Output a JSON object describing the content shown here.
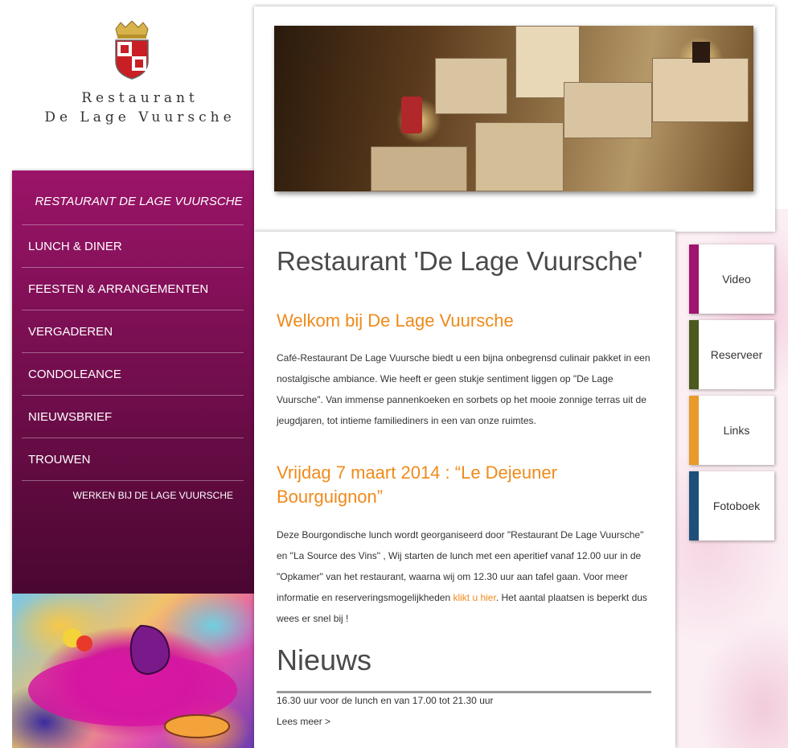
{
  "brand": {
    "line1": "Restaurant",
    "line2": "De Lage Vuursche",
    "logo_icon": "crest-icon"
  },
  "nav": {
    "title": "RESTAURANT DE LAGE VUURSCHE",
    "items": [
      {
        "label": "LUNCH & DINER"
      },
      {
        "label": "FEESTEN & ARRANGEMENTEN"
      },
      {
        "label": "VERGADEREN"
      },
      {
        "label": "CONDOLEANCE"
      },
      {
        "label": "NIEUWSBRIEF"
      },
      {
        "label": "TROUWEN"
      }
    ],
    "sub_link": "WERKEN BIJ DE LAGE VUURSCHE"
  },
  "main": {
    "title": "Restaurant 'De Lage Vuursche'",
    "welcome_heading": "Welkom bij De Lage Vuursche",
    "welcome_text": "Café-Restaurant De Lage Vuursche biedt u een bijna onbegrensd culinair pakket in een nostalgische ambiance. Wie heeft er geen stukje sentiment liggen op \"De Lage Vuursche\". Van immense pannenkoeken en sorbets op het mooie zonnige terras uit de jeugdjaren, tot intieme familiediners in een van onze ruimtes.",
    "event_heading": "Vrijdag 7 maart 2014 : “Le Dejeuner Bourguignon”",
    "event_text_before": "Deze Bourgondische lunch wordt georganiseerd door \"Restaurant De Lage Vuursche\" en \"La Source des Vins\" , Wij starten de lunch met een aperitief vanaf 12.00 uur in de \"Opkamer\" van het restaurant, waarna wij om 12.30 uur aan tafel gaan. Voor meer informatie en reserveringsmogelijkheden ",
    "event_link": "klikt u hier",
    "event_text_after": ". Het aantal plaatsen is beperkt dus wees er snel bij !",
    "news_heading": "Nieuws",
    "news_text": "16.30 uur voor de lunch en van 17.00 tot 21.30 uur",
    "news_more": "Lees meer >"
  },
  "tabs": [
    {
      "label": "Video",
      "color": "#a0136e"
    },
    {
      "label": "Reserveer",
      "color": "#4a5a1e"
    },
    {
      "label": "Links",
      "color": "#e89a2a"
    },
    {
      "label": "Fotoboek",
      "color": "#1d4f78"
    }
  ]
}
